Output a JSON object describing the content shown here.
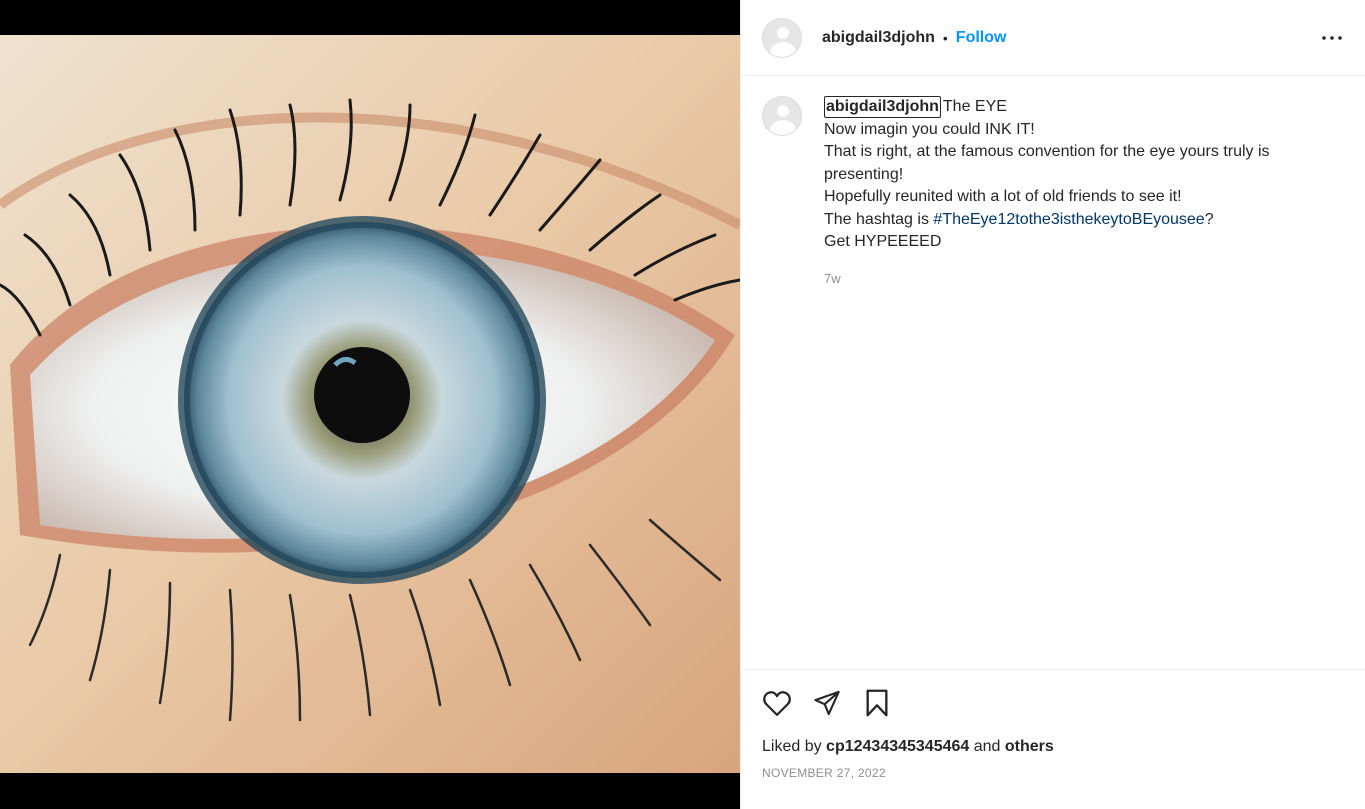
{
  "post": {
    "author": "abigdail3djohn",
    "dot": "•",
    "follow_label": "Follow",
    "more_icon": "more-horizontal-icon"
  },
  "caption": {
    "author": "abigdail3djohn",
    "first_line": "The EYE",
    "lines": [
      "Now imagin you could INK IT!",
      "That is right, at the famous convention for the eye yours truly is presenting!",
      "Hopefully reunited with a lot of old friends to see it!"
    ],
    "hashtag_prefix": "The hashtag is ",
    "hashtag": "#TheEye12tothe3isthekeytoBEyousee",
    "hashtag_suffix": "?",
    "last_line": "Get HYPEEEED",
    "time": "7w"
  },
  "actions": {
    "like_icon": "heart-icon",
    "share_icon": "paper-plane-icon",
    "save_icon": "bookmark-icon"
  },
  "likes": {
    "prefix": "Liked by ",
    "user": "cp12434345345464",
    "middle": " and ",
    "others": "others"
  },
  "date": "NOVEMBER 27, 2022",
  "colors": {
    "link_blue": "#0095f6",
    "hashtag_blue": "#00376b",
    "muted": "#8e8e8e"
  }
}
